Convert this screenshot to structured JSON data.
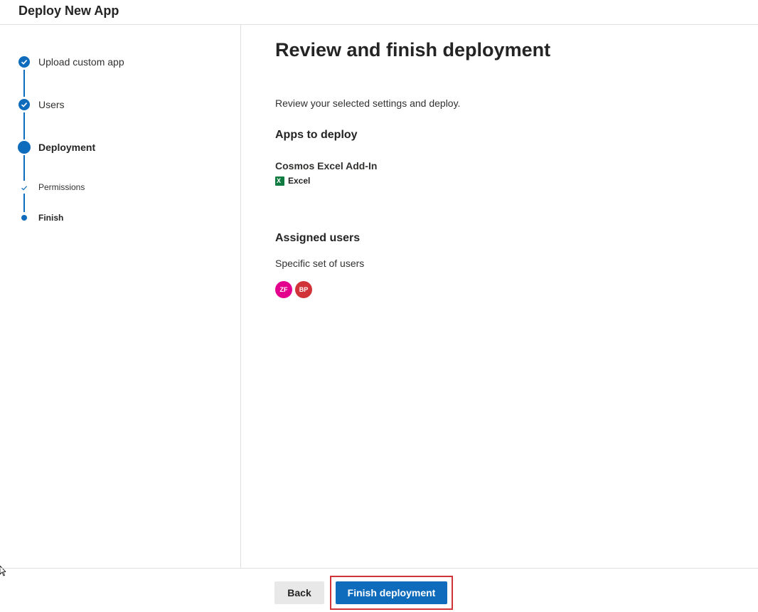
{
  "header": {
    "title": "Deploy New App"
  },
  "stepper": {
    "steps": [
      {
        "label": "Upload custom app",
        "state": "completed"
      },
      {
        "label": "Users",
        "state": "completed"
      },
      {
        "label": "Deployment",
        "state": "current"
      }
    ],
    "substeps": [
      {
        "label": "Permissions",
        "state": "completed"
      },
      {
        "label": "Finish",
        "state": "current"
      }
    ]
  },
  "main": {
    "title": "Review and finish deployment",
    "description": "Review your selected settings and deploy.",
    "apps_section": {
      "title": "Apps to deploy",
      "app_name": "Cosmos Excel Add-In",
      "host": "Excel",
      "host_icon": "excel-icon"
    },
    "users_section": {
      "title": "Assigned users",
      "subtitle": "Specific set of users",
      "avatars": [
        {
          "initials": "ZF",
          "color": "#e3008c"
        },
        {
          "initials": "BP",
          "color": "#d13438"
        }
      ]
    }
  },
  "footer": {
    "back_label": "Back",
    "finish_label": "Finish deployment"
  },
  "colors": {
    "accent": "#0f6cbd",
    "highlight": "#d13438",
    "excel": "#107c41"
  }
}
